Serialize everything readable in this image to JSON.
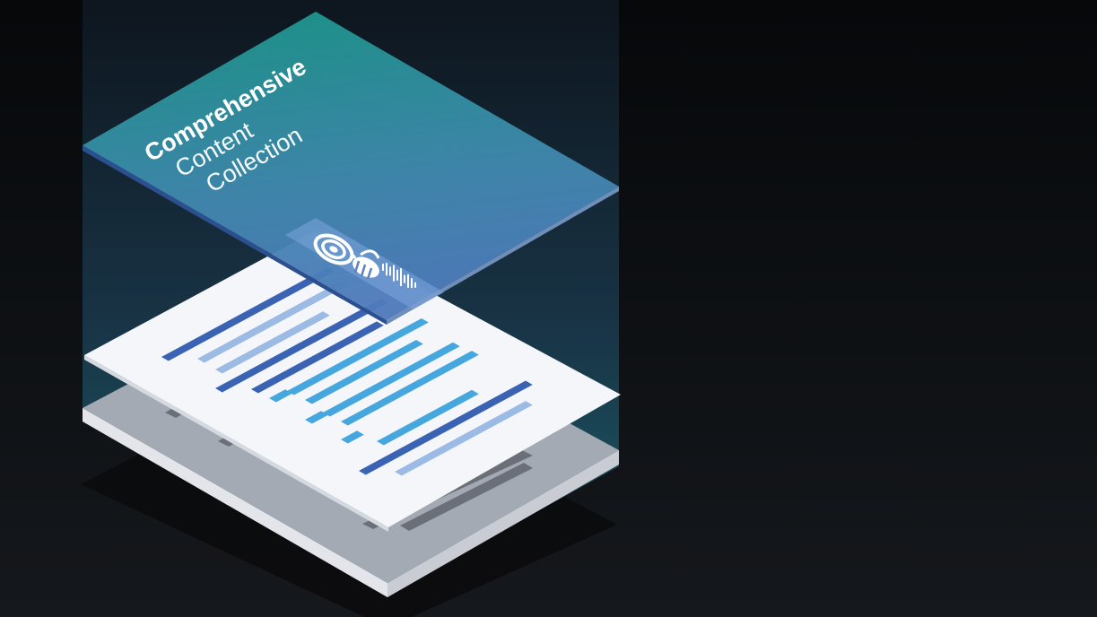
{
  "title": {
    "line1": "Comprehensive",
    "line2": "Content",
    "line3": "Collection"
  },
  "colors": {
    "background_top": "#07090b",
    "background_bottom": "#14171b",
    "top_panel_start": "#1f948e",
    "top_panel_end": "#4e7bbb",
    "top_panel_edge": "#2a4f8e",
    "document_face": "#f4f6fa",
    "document_edge": "#d6dae2",
    "tray_face": "#a2a9b2",
    "tray_edge": "#e2e4ea",
    "bar_dark_blue": "#3a63b3",
    "bar_light_blue": "#9bbbe4",
    "bar_sky_blue": "#46a7de",
    "glass_teal": "#1f6f79"
  },
  "icons": {
    "logo": "radar-bee-logo-icon",
    "sound_bars": "audio-waveform-icon"
  }
}
